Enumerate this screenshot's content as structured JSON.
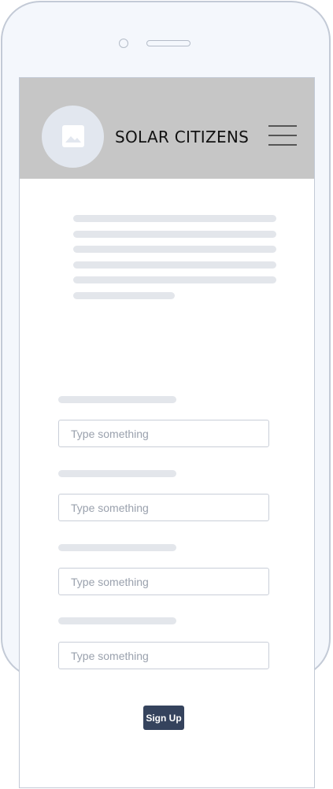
{
  "header": {
    "brand": "SOLAR CITIZENS",
    "logo_icon": "image-placeholder-icon",
    "menu_icon": "hamburger-menu-icon"
  },
  "form": {
    "fields": [
      {
        "placeholder": "Type something"
      },
      {
        "placeholder": "Type something"
      },
      {
        "placeholder": "Type something"
      },
      {
        "placeholder": "Type something"
      }
    ],
    "submit_label": "Sign Up"
  },
  "colors": {
    "header_bg": "#c6c6c6",
    "button_bg": "#35435d",
    "skeleton": "#e3e6eb",
    "device_bg": "#f4f7fc"
  }
}
